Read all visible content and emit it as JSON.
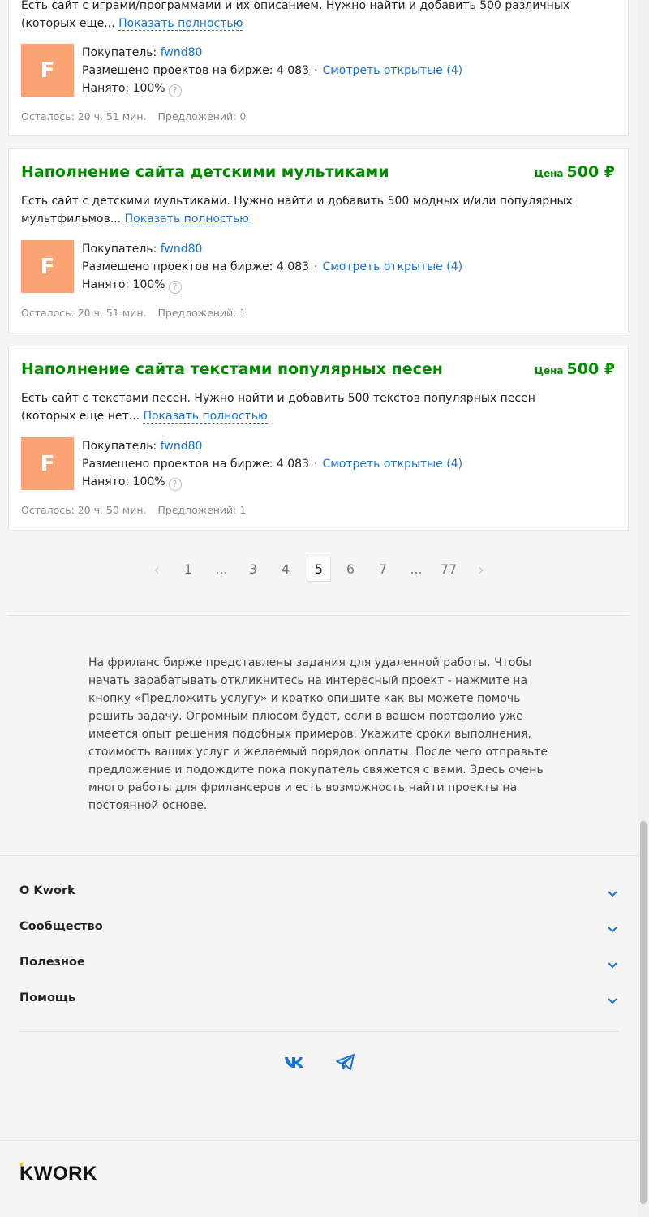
{
  "projects": [
    {
      "title": "",
      "price_label": "",
      "price": "",
      "desc": "Есть сайт с играми/программами и их описанием. Нужно найти и добавить 500 различных (которых еще...",
      "show_more": "Показать полностью",
      "avatar_letter": "F",
      "buyer_label": "Покупатель:",
      "buyer": "fwnd80",
      "placed_label": "Размещено проектов на бирже: 4 083",
      "open_link": "Смотреть открытые (4)",
      "hired_label": "Нанято: 100%",
      "remaining": "Осталось: 20 ч. 51 мин.",
      "offers": "Предложений: 0"
    },
    {
      "title": "Наполнение сайта детскими мультиками",
      "price_label": "Цена",
      "price": "500 ₽",
      "desc": "Есть сайт с детскими мультиками. Нужно найти и добавить 500 модных и/или популярных мультфильмов...",
      "show_more": "Показать полностью",
      "avatar_letter": "F",
      "buyer_label": "Покупатель:",
      "buyer": "fwnd80",
      "placed_label": "Размещено проектов на бирже: 4 083",
      "open_link": "Смотреть открытые (4)",
      "hired_label": "Нанято: 100%",
      "remaining": "Осталось: 20 ч. 51 мин.",
      "offers": "Предложений: 1"
    },
    {
      "title": "Наполнение сайта текстами популярных песен",
      "price_label": "Цена",
      "price": "500 ₽",
      "desc": "Есть сайт с текстами песен. Нужно найти и добавить 500 текстов популярных песен (которых еще нет...",
      "show_more": "Показать полностью",
      "avatar_letter": "F",
      "buyer_label": "Покупатель:",
      "buyer": "fwnd80",
      "placed_label": "Размещено проектов на бирже: 4 083",
      "open_link": "Смотреть открытые (4)",
      "hired_label": "Нанято: 100%",
      "remaining": "Осталось: 20 ч. 50 мин.",
      "offers": "Предложений: 1"
    }
  ],
  "pagination": {
    "prev": "‹",
    "next": "›",
    "pages": [
      "1",
      "...",
      "3",
      "4",
      "5",
      "6",
      "7",
      "...",
      "77"
    ],
    "current": "5"
  },
  "seo_text": "На фриланс бирже представлены задания для удаленной работы. Чтобы начать зарабатывать откликнитесь на интересный проект - нажмите на кнопку «Предложить услугу» и кратко опишите как вы можете помочь решить задачу. Огромным плюсом будет, если в вашем портфолио уже имеется опыт решения подобных примеров. Укажите сроки выполнения, стоимость ваших услуг и желаемый порядок оплаты. После чего отправьте предложение и подождите пока покупатель свяжется с вами. Здесь очень много работы для фрилансеров и есть возможность найти проекты на постоянной основе.",
  "footer": {
    "sections": [
      "О Kwork",
      "Сообщество",
      "Полезное",
      "Помощь"
    ],
    "socials": [
      "vk-icon",
      "telegram-icon"
    ],
    "logo": "KWORK"
  },
  "colors": {
    "accent_green": "#008a00",
    "link_blue": "#1773d4",
    "avatar_bg": "#fca373",
    "logo_yellow": "#ffc000"
  }
}
